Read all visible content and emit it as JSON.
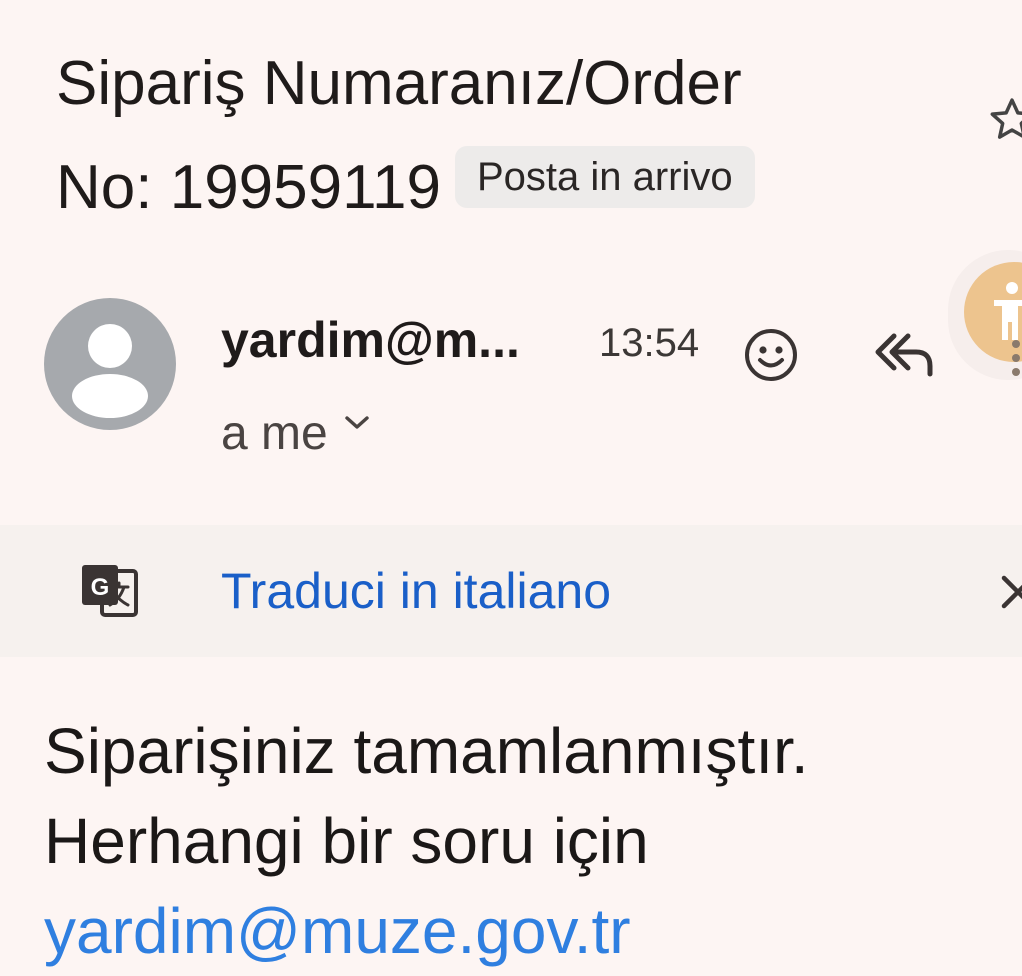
{
  "subject": {
    "line1": "Sipariş Numaranız/Order",
    "line2": "No: 19959119",
    "label_chip": "Posta in arrivo"
  },
  "message_header": {
    "sender": "yardim@m...",
    "time": "13:54",
    "recipient": "a me"
  },
  "translate_bar": {
    "link_label": "Traduci in italiano"
  },
  "message_body": {
    "line1": "Siparişiniz tamamlanmıştır.",
    "line2": "Herhangi bir soru için",
    "link": "yardim@muze.gov.tr"
  },
  "icons": {
    "star": "star-outline-icon",
    "accessibility": "accessibility-icon",
    "avatar": "person-icon",
    "emoji": "emoji-reaction-icon",
    "reply_all": "reply-all-icon",
    "expand": "chevron-down-icon",
    "translate": "google-translate-icon",
    "close": "close-icon"
  },
  "colors": {
    "background": "#FDF5F3",
    "link_blue": "#1A5FC8",
    "body_link": "#2F7FE0",
    "avatar_gray": "#A6A9AD",
    "chip_bg": "#EDEBEA",
    "accessibility_fab": "#EDC48E"
  }
}
